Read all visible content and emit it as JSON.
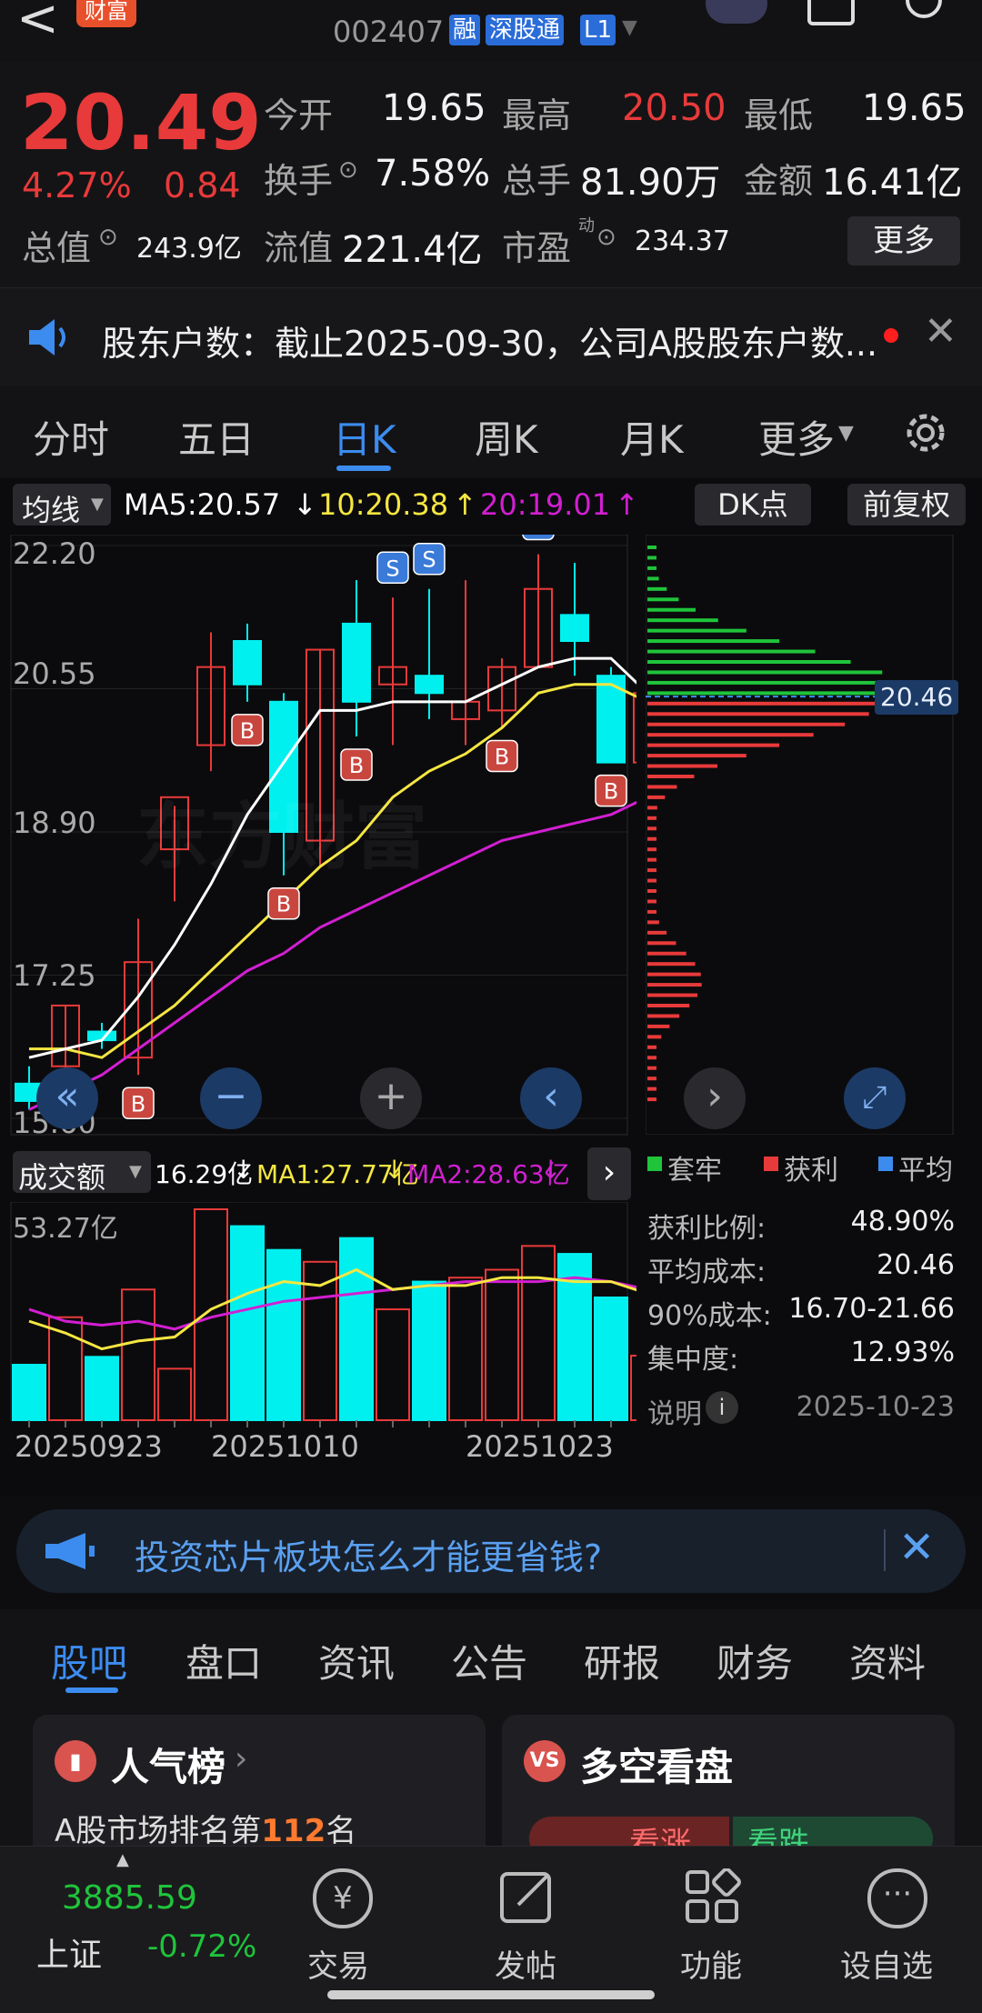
{
  "header": {
    "back_label": "<",
    "brand_badge": "财富",
    "stock_code": "002407",
    "tag_margin": "融",
    "tag_connect": "深股通",
    "tag_level": "L1"
  },
  "quote": {
    "price": "20.49",
    "change_pct": "4.27%",
    "change_amt": "0.84",
    "open_label": "今开",
    "open": "19.65",
    "high_label": "最高",
    "high": "20.50",
    "low_label": "最低",
    "low": "19.65",
    "turnover_label": "换手",
    "turnover": "7.58%",
    "volume_label": "总手",
    "volume": "81.90万",
    "amount_label": "金额",
    "amount": "16.41亿",
    "mktcap_label": "总值",
    "mktcap": "243.9亿",
    "float_label": "流值",
    "float": "221.4亿",
    "pe_label": "市盈",
    "pe_sup": "动",
    "pe": "234.37",
    "more_button": "更多"
  },
  "notice": {
    "text": "股东户数：截止2025-09-30，公司A股股东户数..."
  },
  "period_tabs": [
    "分时",
    "五日",
    "日K",
    "周K",
    "月K",
    "更多"
  ],
  "period_active": 2,
  "ma_bar": {
    "selector": "均线",
    "ma5": "MA5:20.57",
    "ma10": "10:20.38",
    "ma20": "20:19.01",
    "dk_button": "DK点",
    "adjust_button": "前复权"
  },
  "kline": {
    "y_labels": [
      "22.20",
      "20.55",
      "18.90",
      "17.25",
      "15.60"
    ],
    "price_tag": "20.46",
    "watermark": "东方财富"
  },
  "volume_bar": {
    "selector": "成交额",
    "value": "16.29亿",
    "ma1": "MA1:27.77亿",
    "ma2": "MA2:28.63亿",
    "max_label": "53.27亿",
    "dates": [
      "20250923",
      "20251010",
      "20251023"
    ]
  },
  "chips": {
    "legend": [
      "套牢",
      "获利",
      "平均"
    ],
    "rows": [
      {
        "label": "获利比例:",
        "value": "48.90%"
      },
      {
        "label": "平均成本:",
        "value": "20.46"
      },
      {
        "label": "90%成本:",
        "value": "16.70-21.66"
      },
      {
        "label": "集中度:",
        "value": "12.93%"
      }
    ],
    "explain": "说明",
    "date": "2025-10-23"
  },
  "ad": {
    "text": "投资芯片板块怎么才能更省钱?"
  },
  "section_tabs": [
    "股吧",
    "盘口",
    "资讯",
    "公告",
    "研报",
    "财务",
    "资料"
  ],
  "cards": {
    "popularity_title": "人气榜",
    "popularity_sub_prefix": "A股市场排名第",
    "popularity_rank": "112",
    "popularity_sub_suffix": "名",
    "bullbear_title": "多空看盘",
    "bull_label": "看涨",
    "bear_label": "看跌"
  },
  "bottom_nav": {
    "index_value": "3885.59",
    "index_name": "上证",
    "index_change": "-0.72%",
    "items": [
      "交易",
      "发帖",
      "功能",
      "设自选"
    ]
  },
  "colors": {
    "up": "#e83a3a",
    "down": "#1fc43a",
    "accent": "#3c8cf0",
    "candle_down": "#00f0f0",
    "ma5": "#ffffff",
    "ma10": "#f5e642",
    "ma20": "#d21fd2"
  },
  "chart_data": {
    "type": "candlestick",
    "candles": [
      {
        "o": 16.0,
        "h": 16.2,
        "l": 15.7,
        "c": 15.8
      },
      {
        "o": 16.2,
        "h": 16.9,
        "l": 15.9,
        "c": 16.9
      },
      {
        "o": 16.6,
        "h": 16.7,
        "l": 16.4,
        "c": 16.5
      },
      {
        "o": 16.3,
        "h": 17.9,
        "l": 16.1,
        "c": 17.4
      },
      {
        "o": 18.7,
        "h": 19.2,
        "l": 18.1,
        "c": 19.3
      },
      {
        "o": 19.9,
        "h": 21.2,
        "l": 19.6,
        "c": 20.8
      },
      {
        "o": 21.1,
        "h": 21.3,
        "l": 20.4,
        "c": 20.6
      },
      {
        "o": 20.4,
        "h": 20.5,
        "l": 18.4,
        "c": 18.9
      },
      {
        "o": 18.8,
        "h": 21.0,
        "l": 18.5,
        "c": 21.0
      },
      {
        "o": 21.3,
        "h": 21.8,
        "l": 20.0,
        "c": 20.4
      },
      {
        "o": 20.6,
        "h": 21.6,
        "l": 19.9,
        "c": 20.8
      },
      {
        "o": 20.7,
        "h": 21.7,
        "l": 20.2,
        "c": 20.5
      },
      {
        "o": 20.2,
        "h": 21.8,
        "l": 19.9,
        "c": 20.4
      },
      {
        "o": 20.3,
        "h": 20.9,
        "l": 20.1,
        "c": 20.8
      },
      {
        "o": 20.8,
        "h": 22.1,
        "l": 20.8,
        "c": 21.7
      },
      {
        "o": 21.4,
        "h": 22.0,
        "l": 20.7,
        "c": 21.1
      },
      {
        "o": 20.7,
        "h": 20.8,
        "l": 19.7,
        "c": 19.7
      },
      {
        "o": 19.7,
        "h": 20.6,
        "l": 19.0,
        "c": 20.5
      }
    ],
    "ma5": [
      16.3,
      16.4,
      16.5,
      17.0,
      17.6,
      18.3,
      19.1,
      19.7,
      20.3,
      20.3,
      20.4,
      20.4,
      20.4,
      20.6,
      20.8,
      20.9,
      20.9,
      20.5
    ],
    "ma10": [
      16.4,
      16.4,
      16.3,
      16.6,
      16.9,
      17.3,
      17.7,
      18.1,
      18.5,
      18.8,
      19.3,
      19.6,
      19.8,
      20.1,
      20.5,
      20.6,
      20.6,
      20.4
    ],
    "ma20": [
      15.7,
      15.9,
      16.1,
      16.4,
      16.7,
      17.0,
      17.3,
      17.5,
      17.8,
      18.0,
      18.2,
      18.4,
      18.6,
      18.8,
      18.9,
      19.0,
      19.1,
      19.3
    ],
    "volume": [
      14.0,
      26.0,
      16.0,
      33.0,
      13.0,
      53.27,
      49.0,
      43.0,
      40.0,
      46.0,
      28.0,
      35.0,
      36.0,
      38.0,
      44.0,
      42.0,
      31.0,
      16.29
    ],
    "vol_ma1": [
      25,
      22,
      18,
      20,
      21,
      28,
      32,
      35,
      34,
      38,
      33,
      34,
      34,
      36,
      36,
      35,
      35,
      32
    ],
    "vol_ma2": [
      28,
      25,
      24,
      25,
      23,
      26,
      28,
      30,
      31,
      32,
      33,
      34,
      35,
      35,
      35,
      36,
      35,
      33
    ],
    "ylim": [
      15.6,
      22.2
    ],
    "signals": [
      {
        "i": 3,
        "t": "B"
      },
      {
        "i": 6,
        "t": "B"
      },
      {
        "i": 7,
        "t": "B"
      },
      {
        "i": 9,
        "t": "B"
      },
      {
        "i": 10,
        "t": "S"
      },
      {
        "i": 11,
        "t": "S"
      },
      {
        "i": 13,
        "t": "B"
      },
      {
        "i": 14,
        "t": "S"
      },
      {
        "i": 16,
        "t": "B"
      }
    ]
  }
}
